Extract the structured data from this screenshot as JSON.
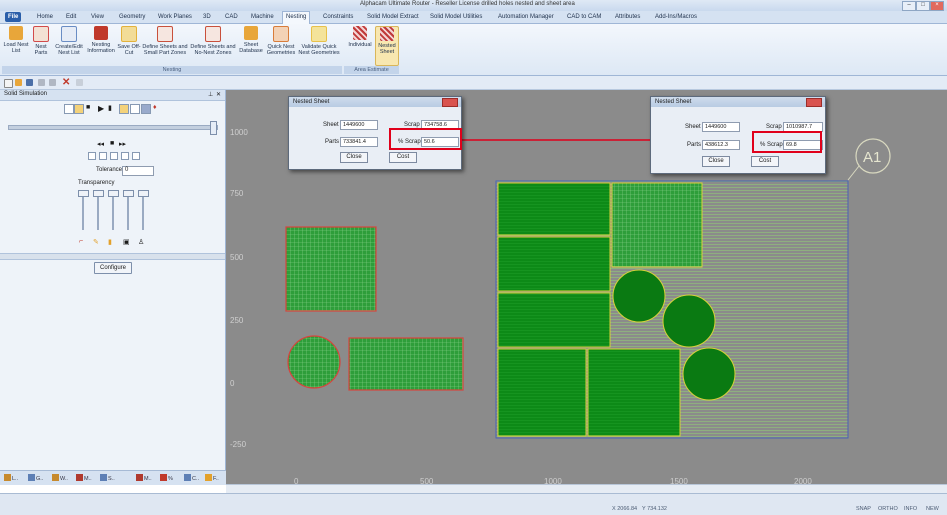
{
  "window": {
    "title": "Alphacam Ultimate Router - Reseller License  drilled holes nested and sheet area"
  },
  "menu": {
    "tabs": [
      "File",
      "Home",
      "Edit",
      "View",
      "Geometry",
      "Work Planes",
      "3D",
      "CAD",
      "Machine",
      "Nesting",
      "Constraints",
      "Solid Model Extract",
      "Solid Model Utilities",
      "Automation Manager",
      "CAD to CAM",
      "Attributes",
      "Add-Ins/Macros"
    ],
    "active": "Nesting"
  },
  "ribbon": {
    "buttons": [
      {
        "label": "Load Nest List",
        "icon": "folder-icon",
        "color": "#e8a63a"
      },
      {
        "label": "Nest Parts",
        "icon": "nest-icon",
        "color": "#d24b4b"
      },
      {
        "label": "Create/Edit Nest List",
        "icon": "list-icon",
        "color": "#6a8dc4"
      },
      {
        "label": "Nesting Information",
        "icon": "info-icon",
        "color": "#c0392b"
      },
      {
        "label": "Save Off-Cut",
        "icon": "offcut-icon",
        "color": "#e3b23c"
      },
      {
        "label": "Define Sheets and Small Part Zones",
        "icon": "sheet-zone-icon",
        "color": "#c8503c"
      },
      {
        "label": "Define Sheets and No-Nest Zones",
        "icon": "no-nest-icon",
        "color": "#c8503c"
      },
      {
        "label": "Sheet Database",
        "icon": "database-icon",
        "color": "#e8a63a"
      },
      {
        "label": "Quick Nest Geometries",
        "icon": "quick-nest-icon",
        "color": "#d87c3a"
      },
      {
        "label": "Validate Quick Nest Geometries",
        "icon": "validate-icon",
        "color": "#e8c14a"
      },
      {
        "label": "Individual",
        "icon": "individual-icon",
        "color": "#c03a3a"
      },
      {
        "label": "Nested Sheet",
        "icon": "nested-sheet-icon",
        "color": "#c03a3a"
      }
    ],
    "groups": [
      "Nesting",
      "Area Estimate"
    ]
  },
  "left_panel": {
    "title": "Solid Simulation",
    "tolerance_label": "Tolerance",
    "tolerance_value": "0",
    "transparency_label": "Transparency",
    "configure_label": "Configure",
    "bottom_tabs": [
      "L..",
      "G..",
      "W..",
      "M..",
      "S..",
      "M..",
      "%",
      "C..",
      "F.."
    ]
  },
  "dialogs": [
    {
      "title": "Nested Sheet",
      "sheet_label": "Sheet",
      "sheet_value": "1449600",
      "scrap_label": "Scrap",
      "scrap_value": "734758.6",
      "parts_label": "Parts",
      "parts_value": "733841.4",
      "pct_label": "% Scrap",
      "pct_value": "50.6",
      "close_label": "Close",
      "cost_label": "Cost"
    },
    {
      "title": "Nested Sheet",
      "sheet_label": "Sheet",
      "sheet_value": "1449600",
      "scrap_label": "Scrap",
      "scrap_value": "1010987.7",
      "parts_label": "Parts",
      "parts_value": "438612.3",
      "pct_label": "% Scrap",
      "pct_value": "69.8",
      "close_label": "Close",
      "cost_label": "Cost"
    }
  ],
  "canvas": {
    "y_ticks": [
      "1000",
      "750",
      "500",
      "250",
      "0",
      "-250"
    ],
    "x_ticks": [
      "0",
      "500",
      "1000",
      "1500",
      "2000"
    ],
    "sheet_label": "A1",
    "colors": {
      "background": "#8b8b8b",
      "parts_fill": "#2e9e3a",
      "dense_fill": "#0a7a12",
      "outline": "#d9d23a",
      "part_border": "#d8433c",
      "highlight": "#e0001b"
    }
  },
  "status": {
    "x_coord": "X 2066.84",
    "y_coord": "Y 734.132",
    "modes": [
      "SNAP",
      "ORTHO",
      "INFO",
      "NEW"
    ]
  }
}
